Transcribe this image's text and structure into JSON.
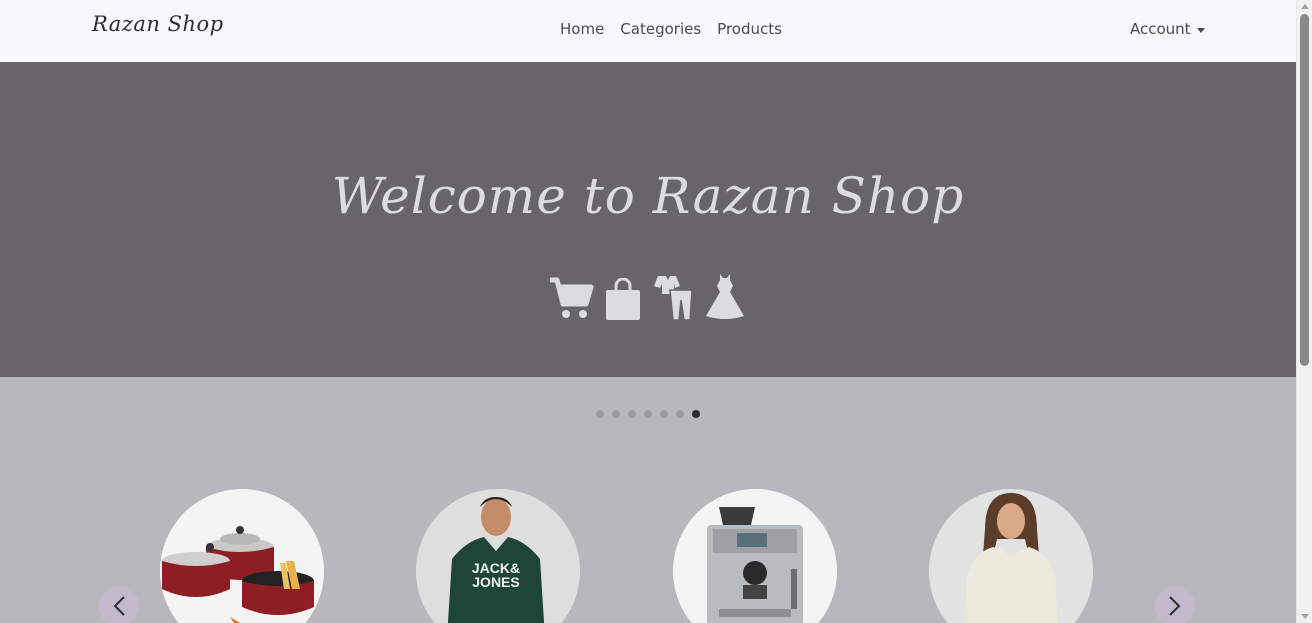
{
  "navbar": {
    "brand": "Razan Shop",
    "links": [
      "Home",
      "Categories",
      "Products"
    ],
    "account_label": "Account"
  },
  "hero": {
    "title": "Welcome to Razan Shop",
    "icons": [
      "cart-icon",
      "shopping-bag-icon",
      "clothes-icon",
      "dress-icon"
    ]
  },
  "carousel": {
    "slide_count": 7,
    "active_index": 6,
    "products": [
      "cookware-set",
      "hoodie-man",
      "espresso-machine",
      "sweater-woman"
    ],
    "prev_icon": "chevron-left-icon",
    "next_icon": "chevron-right-icon"
  },
  "colors": {
    "navbar_bg": "#f8f9fa",
    "hero_bg": "#676569",
    "page_bg": "#b7b8be",
    "arrow_bg": "#c4b9cc"
  }
}
